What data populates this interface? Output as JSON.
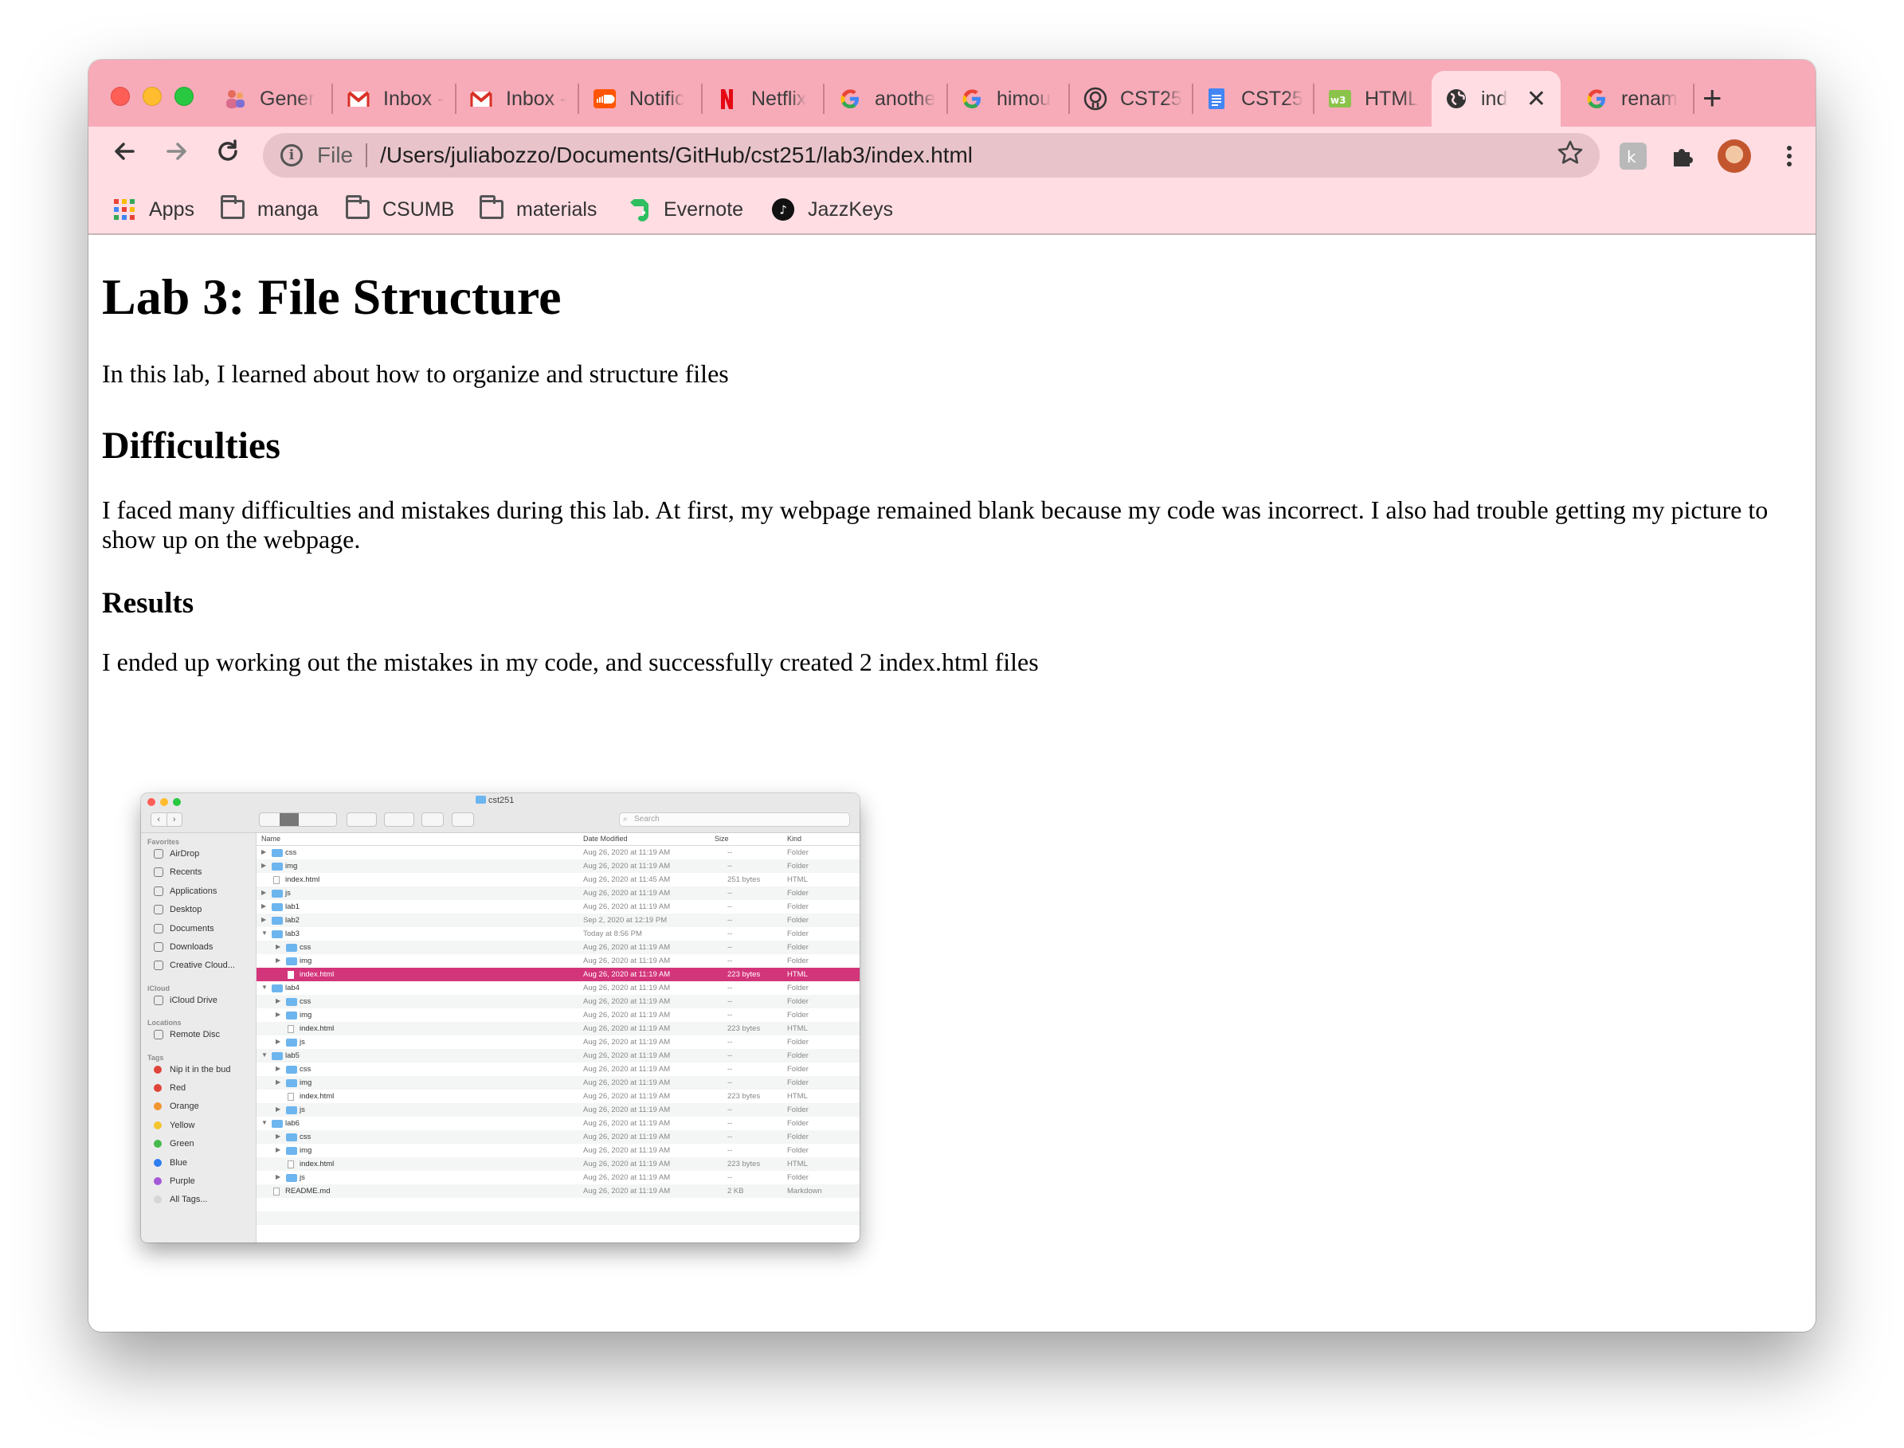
{
  "browser": {
    "tabs": [
      {
        "title": "Gener",
        "icon": "teams-icon",
        "active": false
      },
      {
        "title": "Inbox -",
        "icon": "gmail-icon",
        "active": false
      },
      {
        "title": "Inbox -",
        "icon": "gmail-icon",
        "active": false
      },
      {
        "title": "Notific",
        "icon": "soundcloud-icon",
        "active": false
      },
      {
        "title": "Netflix",
        "icon": "netflix-icon",
        "active": false
      },
      {
        "title": "anothe",
        "icon": "google-icon",
        "active": false
      },
      {
        "title": "himou",
        "icon": "google-icon",
        "active": false
      },
      {
        "title": "CST25",
        "icon": "github-icon",
        "active": false
      },
      {
        "title": "CST25",
        "icon": "google-docs-icon",
        "active": false
      },
      {
        "title": "HTML",
        "icon": "w3schools-icon",
        "active": false
      },
      {
        "title": "ind",
        "icon": "globe-icon",
        "active": true
      },
      {
        "title": "renam",
        "icon": "google-icon",
        "active": false
      }
    ],
    "new_tab_label": "+",
    "close_label": "✕",
    "address": {
      "scheme_label": "File",
      "url": "/Users/juliabozzo/Documents/GitHub/cst251/lab3/index.html"
    },
    "bookmarks": [
      {
        "label": "Apps",
        "icon": "apps-grid-icon"
      },
      {
        "label": "manga",
        "icon": "folder-icon"
      },
      {
        "label": "CSUMB",
        "icon": "folder-icon"
      },
      {
        "label": "materials",
        "icon": "folder-icon"
      },
      {
        "label": "Evernote",
        "icon": "evernote-icon"
      },
      {
        "label": "JazzKeys",
        "icon": "jazzkeys-icon"
      }
    ],
    "colors": {
      "tabbar": "#f7aab8",
      "toolbar": "#ffdde3"
    }
  },
  "page": {
    "h1": "Lab 3: File Structure",
    "intro": "In this lab, I learned about how to organize and structure files",
    "h2": "Difficulties",
    "difficulties": "I faced many difficulties and mistakes during this lab. At first, my webpage remained blank because my code was incorrect. I also had trouble getting my picture to show up on the webpage.",
    "h3": "Results",
    "results": "I ended up working out the mistakes in my code, and successfully created 2 index.html files"
  },
  "finder": {
    "title": "cst251",
    "search_placeholder": "Search",
    "columns": {
      "name": "Name",
      "date": "Date Modified",
      "size": "Size",
      "kind": "Kind"
    },
    "sidebar": {
      "favorites_label": "Favorites",
      "favorites": [
        "AirDrop",
        "Recents",
        "Applications",
        "Desktop",
        "Documents",
        "Downloads",
        "Creative Cloud..."
      ],
      "icloud_label": "iCloud",
      "icloud": [
        "iCloud Drive"
      ],
      "locations_label": "Locations",
      "locations": [
        "Remote Disc"
      ],
      "tags_label": "Tags",
      "tags": [
        {
          "name": "Nip it in the bud",
          "color": "#e0443a"
        },
        {
          "name": "Red",
          "color": "#e0443a"
        },
        {
          "name": "Orange",
          "color": "#f0952f"
        },
        {
          "name": "Yellow",
          "color": "#f3c530"
        },
        {
          "name": "Green",
          "color": "#45b94b"
        },
        {
          "name": "Blue",
          "color": "#2f7ef0"
        },
        {
          "name": "Purple",
          "color": "#a45ad6"
        },
        {
          "name": "All Tags...",
          "color": "#d6d6d6"
        }
      ]
    },
    "rows": [
      {
        "name": "css",
        "level": 0,
        "type": "folder",
        "disc": "▶",
        "date": "Aug 26, 2020 at 11:19 AM",
        "size": "--",
        "kind": "Folder"
      },
      {
        "name": "img",
        "level": 0,
        "type": "folder",
        "disc": "▶",
        "date": "Aug 26, 2020 at 11:19 AM",
        "size": "--",
        "kind": "Folder"
      },
      {
        "name": "index.html",
        "level": 0,
        "type": "file",
        "disc": "",
        "date": "Aug 26, 2020 at 11:45 AM",
        "size": "251 bytes",
        "kind": "HTML"
      },
      {
        "name": "js",
        "level": 0,
        "type": "folder",
        "disc": "▶",
        "date": "Aug 26, 2020 at 11:19 AM",
        "size": "--",
        "kind": "Folder"
      },
      {
        "name": "lab1",
        "level": 0,
        "type": "folder",
        "disc": "▶",
        "date": "Aug 26, 2020 at 11:19 AM",
        "size": "--",
        "kind": "Folder"
      },
      {
        "name": "lab2",
        "level": 0,
        "type": "folder",
        "disc": "▶",
        "date": "Sep 2, 2020 at 12:19 PM",
        "size": "--",
        "kind": "Folder"
      },
      {
        "name": "lab3",
        "level": 0,
        "type": "folder",
        "disc": "▼",
        "date": "Today at 8:56 PM",
        "size": "--",
        "kind": "Folder"
      },
      {
        "name": "css",
        "level": 1,
        "type": "folder",
        "disc": "▶",
        "date": "Aug 26, 2020 at 11:19 AM",
        "size": "--",
        "kind": "Folder"
      },
      {
        "name": "img",
        "level": 1,
        "type": "folder",
        "disc": "▶",
        "date": "Aug 26, 2020 at 11:19 AM",
        "size": "--",
        "kind": "Folder"
      },
      {
        "name": "index.html",
        "level": 1,
        "type": "file",
        "disc": "",
        "date": "Aug 26, 2020 at 11:19 AM",
        "size": "223 bytes",
        "kind": "HTML",
        "selected": true
      },
      {
        "name": "lab4",
        "level": 0,
        "type": "folder",
        "disc": "▼",
        "date": "Aug 26, 2020 at 11:19 AM",
        "size": "--",
        "kind": "Folder"
      },
      {
        "name": "css",
        "level": 1,
        "type": "folder",
        "disc": "▶",
        "date": "Aug 26, 2020 at 11:19 AM",
        "size": "--",
        "kind": "Folder"
      },
      {
        "name": "img",
        "level": 1,
        "type": "folder",
        "disc": "▶",
        "date": "Aug 26, 2020 at 11:19 AM",
        "size": "--",
        "kind": "Folder"
      },
      {
        "name": "index.html",
        "level": 1,
        "type": "file",
        "disc": "",
        "date": "Aug 26, 2020 at 11:19 AM",
        "size": "223 bytes",
        "kind": "HTML"
      },
      {
        "name": "js",
        "level": 1,
        "type": "folder",
        "disc": "▶",
        "date": "Aug 26, 2020 at 11:19 AM",
        "size": "--",
        "kind": "Folder"
      },
      {
        "name": "lab5",
        "level": 0,
        "type": "folder",
        "disc": "▼",
        "date": "Aug 26, 2020 at 11:19 AM",
        "size": "--",
        "kind": "Folder"
      },
      {
        "name": "css",
        "level": 1,
        "type": "folder",
        "disc": "▶",
        "date": "Aug 26, 2020 at 11:19 AM",
        "size": "--",
        "kind": "Folder"
      },
      {
        "name": "img",
        "level": 1,
        "type": "folder",
        "disc": "▶",
        "date": "Aug 26, 2020 at 11:19 AM",
        "size": "--",
        "kind": "Folder"
      },
      {
        "name": "index.html",
        "level": 1,
        "type": "file",
        "disc": "",
        "date": "Aug 26, 2020 at 11:19 AM",
        "size": "223 bytes",
        "kind": "HTML"
      },
      {
        "name": "js",
        "level": 1,
        "type": "folder",
        "disc": "▶",
        "date": "Aug 26, 2020 at 11:19 AM",
        "size": "--",
        "kind": "Folder"
      },
      {
        "name": "lab6",
        "level": 0,
        "type": "folder",
        "disc": "▼",
        "date": "Aug 26, 2020 at 11:19 AM",
        "size": "--",
        "kind": "Folder"
      },
      {
        "name": "css",
        "level": 1,
        "type": "folder",
        "disc": "▶",
        "date": "Aug 26, 2020 at 11:19 AM",
        "size": "--",
        "kind": "Folder"
      },
      {
        "name": "img",
        "level": 1,
        "type": "folder",
        "disc": "▶",
        "date": "Aug 26, 2020 at 11:19 AM",
        "size": "--",
        "kind": "Folder"
      },
      {
        "name": "index.html",
        "level": 1,
        "type": "file",
        "disc": "",
        "date": "Aug 26, 2020 at 11:19 AM",
        "size": "223 bytes",
        "kind": "HTML"
      },
      {
        "name": "js",
        "level": 1,
        "type": "folder",
        "disc": "▶",
        "date": "Aug 26, 2020 at 11:19 AM",
        "size": "--",
        "kind": "Folder"
      },
      {
        "name": "README.md",
        "level": 0,
        "type": "file",
        "disc": "",
        "date": "Aug 26, 2020 at 11:19 AM",
        "size": "2 KB",
        "kind": "Markdown"
      }
    ]
  }
}
